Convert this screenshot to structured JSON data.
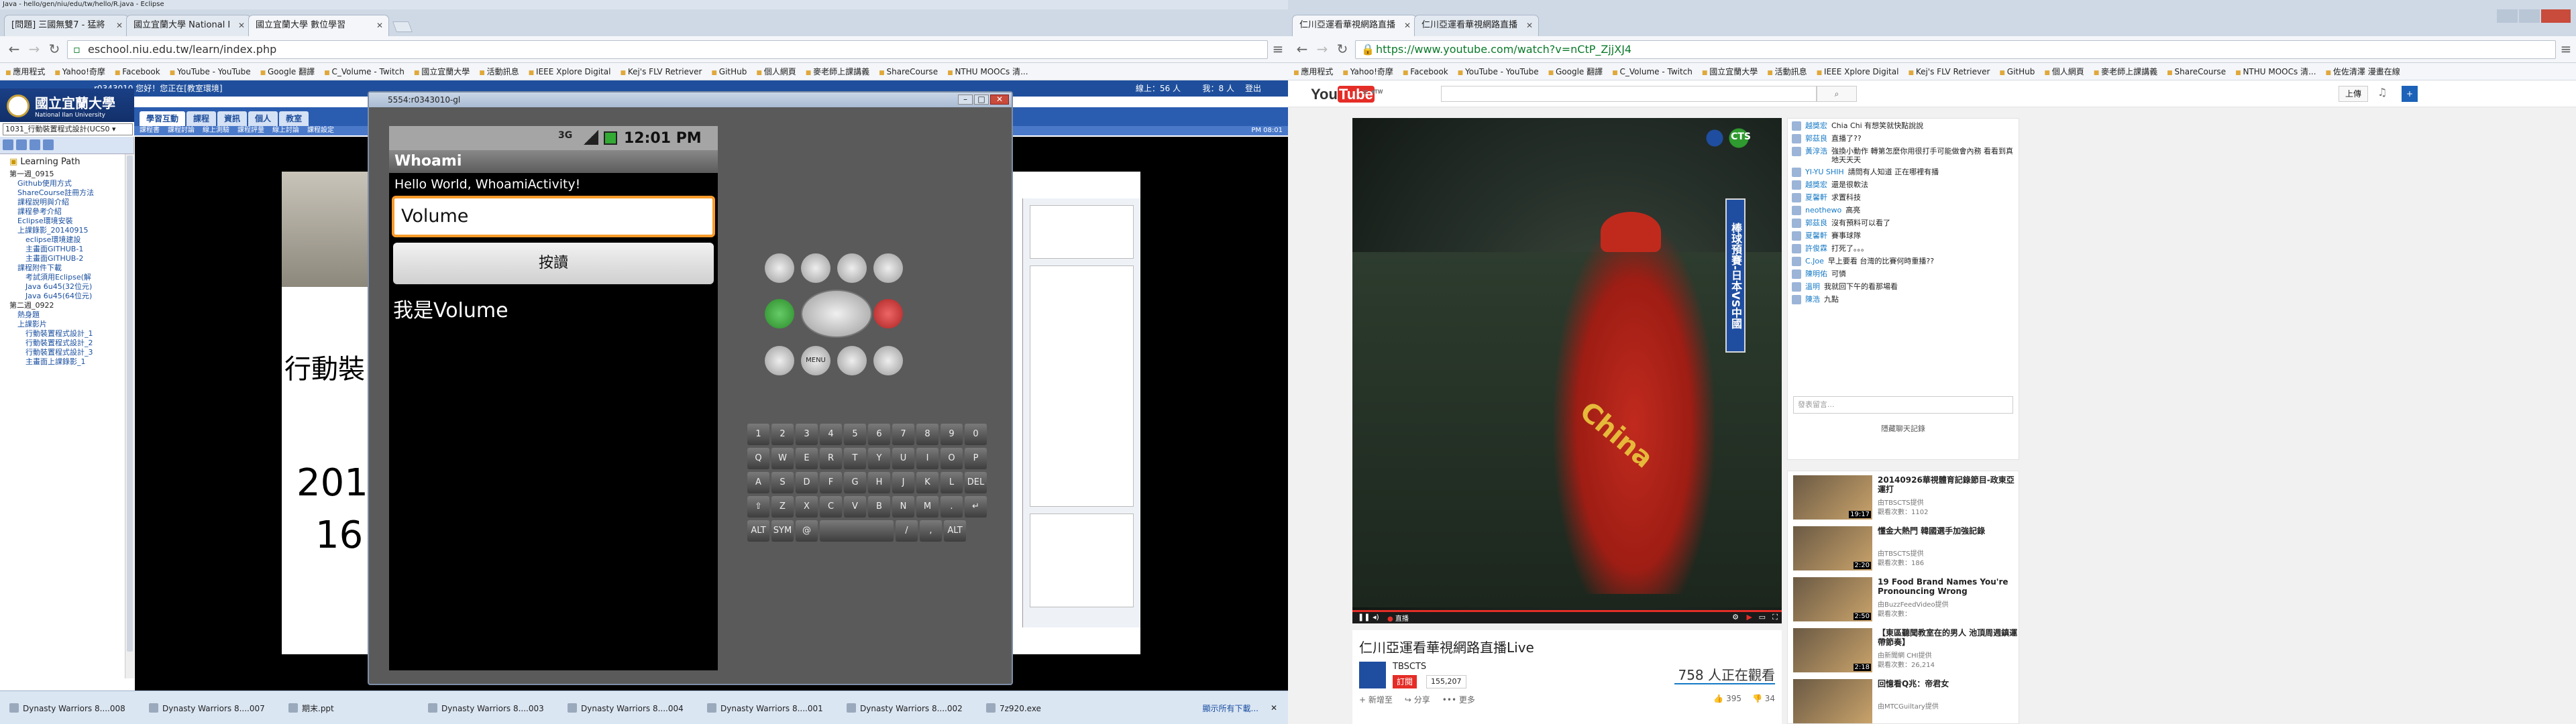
{
  "left_window": {
    "title": "Java - hello/gen/niu/edu/tw/hello/R.java - Eclipse",
    "tabs": [
      {
        "label": "[問題] 三國無雙7 - 猛將"
      },
      {
        "label": "國立宜蘭大學 National I"
      },
      {
        "label": "國立宜蘭大學 數位學習"
      }
    ],
    "url": "eschool.niu.edu.tw/learn/index.php",
    "bookmarks": [
      "應用程式",
      "Yahoo!奇摩",
      "Facebook",
      "YouTube - YouTube",
      "Google 翻譯",
      "C_Volume - Twitch",
      "國立宜蘭大學",
      "活動訊息",
      "IEEE Xplore Digital",
      "Kej's FLV Retriever",
      "GitHub",
      "個人網頁",
      "麥老師上課講義",
      "ShareCourse",
      "NTHU MOOCs 清..."
    ]
  },
  "eschool": {
    "header_text": "r0343010 您好！您正在[教室環境]",
    "online": "線上：56 人",
    "online2": "我：8 人",
    "logout": "登出",
    "logo": "國立宜蘭大學",
    "logo_sub": "National Ilan University",
    "course_select": "1031_行動裝置程式設計(UCS0",
    "nav_tabs": [
      "學習互動",
      "課程",
      "資訊",
      "個人",
      "教室"
    ],
    "subnav": [
      "課程書",
      "課程討論",
      "線上測驗",
      "課程評量",
      "線上討論",
      "課程設定"
    ],
    "time": "PM 08:01",
    "tree_title": "Learning Path",
    "tree": [
      "第一週_0915",
      "Github使用方式",
      "ShareCourse註冊方法",
      "課程說明與介紹",
      "課程參考介紹",
      "Eclipse環境安裝",
      "上課錄影_20140915",
      "eclipse環境建設",
      "主畫面GITHUB-1",
      "主畫面GITHUB-2",
      "課程附件下載",
      "考試須用Eclipse(解",
      "Java 6u45(32位元)",
      "Java 6u45(64位元)",
      "第二週_0922",
      "熱身題",
      "上課影片",
      "行動裝置程式設計_1",
      "行動裝置程式設計_2",
      "行動裝置程式設計_3",
      "主畫面上課錄影_1"
    ],
    "slide_text": [
      "行動裝",
      "2014",
      "16"
    ]
  },
  "emulator": {
    "title": "5554:r0343010-gl",
    "clock": "12:01 PM",
    "net": "3G",
    "app_title": "Whoami",
    "hello": "Hello World, WhoamiActivity!",
    "input_value": "Volume",
    "button": "按讀",
    "output": "我是Volume",
    "keys": [
      [
        "1",
        "2",
        "3",
        "4",
        "5",
        "6",
        "7",
        "8",
        "9",
        "0"
      ],
      [
        "Q",
        "W",
        "E",
        "R",
        "T",
        "Y",
        "U",
        "I",
        "O",
        "P"
      ],
      [
        "A",
        "S",
        "D",
        "F",
        "G",
        "H",
        "J",
        "K",
        "L",
        "DEL"
      ],
      [
        "⇧",
        "Z",
        "X",
        "C",
        "V",
        "B",
        "N",
        "M",
        ".",
        "↵"
      ],
      [
        "ALT",
        "SYM",
        "@",
        "",
        "/",
        ",",
        "ALT"
      ]
    ],
    "keys_sub": [
      [
        "!",
        "@",
        "#",
        "$",
        "%",
        "^",
        "&",
        "*",
        "(",
        ")"
      ]
    ],
    "dpad_label": "MENU"
  },
  "taskbar": {
    "items": [
      "Dynasty Warriors 8....008",
      "Dynasty Warriors 8....007",
      "期末.ppt",
      "Dynasty Warriors 8....003",
      "Dynasty Warriors 8....004",
      "Dynasty Warriors 8....001",
      "Dynasty Warriors 8....002",
      "7z920.exe"
    ],
    "show_all": "顯示所有下載...",
    "clock": "下午 08:01"
  },
  "right_window": {
    "tabs": [
      {
        "label": "仁川亞運看華視網路直播"
      },
      {
        "label": "仁川亞運看華視網路直播"
      }
    ],
    "url": "https://www.youtube.com/watch?v=nCtP_ZjjXJ4",
    "bookmarks": [
      "應用程式",
      "Yahoo!奇摩",
      "Facebook",
      "YouTube - YouTube",
      "Google 翻譯",
      "C_Volume - Twitch",
      "國立宜蘭大學",
      "活動訊息",
      "IEEE Xplore Digital",
      "Kej's FLV Retriever",
      "GitHub",
      "個人網頁",
      "麥老師上課講義",
      "ShareCourse",
      "NTHU MOOCs 清...",
      "佐佐清澤 漫畫在線"
    ]
  },
  "youtube": {
    "logo": "You",
    "logo2": "Tube",
    "logo_sup": "TW",
    "upload": "上傳",
    "video_title": "仁川亞運看華視網路直播Live",
    "channel": "TBSCTS",
    "subscribe": "訂閱",
    "sub_count": "155,207",
    "watching": "758 人正在觀看",
    "live": "直播",
    "likes": "395",
    "dislikes": "34",
    "actions": [
      "新增至",
      "分享",
      "更多"
    ],
    "overlay_logo": "CTS",
    "banner_text": "棒球預賽-日本VS中國",
    "jersey": "China",
    "chat": [
      {
        "user": "越獎宏",
        "msg": "Chia Chi 有想笑就快點說說"
      },
      {
        "user": "郭茲良",
        "msg": "直播了??"
      },
      {
        "user": "黃淳浩",
        "msg": "強換小動作 轉第怎麼你用很打手可能做會內務 看看到真地天天天"
      },
      {
        "user": "YI-YU SHIH",
        "msg": "請問有人知道 正在哪裡有播"
      },
      {
        "user": "越獎宏",
        "msg": "還是很軟法"
      },
      {
        "user": "夏馨軒",
        "msg": "求置科技"
      },
      {
        "user": "neothewo",
        "msg": "高亮"
      },
      {
        "user": "郭茲良",
        "msg": "沒有預料可以看了"
      },
      {
        "user": "夏馨軒",
        "msg": "賽事球隊"
      },
      {
        "user": "許俊霖",
        "msg": "打死了。。。"
      },
      {
        "user": "C.Joe",
        "msg": "早上要看 台灣的比賽何時重播??"
      },
      {
        "user": "陳明佑",
        "msg": "可憐"
      },
      {
        "user": "溫明",
        "msg": "我就回下午的看那場看"
      },
      {
        "user": "陳浩",
        "msg": "九點"
      }
    ],
    "chat_placeholder": "發表留言...",
    "chat_link": "隱藏聊天記錄",
    "related": [
      {
        "title": "20140926華視體育記錄節目-政東亞運打",
        "channel": "由TBSCTS提供",
        "views": "觀看次數：1102",
        "duration": "19:17"
      },
      {
        "title": "懂金大熱門 韓國選手加強記錄",
        "channel": "由TBSCTS提供",
        "views": "觀看次數：186",
        "duration": "2:20"
      },
      {
        "title": "19 Food Brand Names You're Pronouncing Wrong",
        "channel": "由BuzzFeedVideo提供",
        "views": "觀看次數：",
        "duration": "2:50"
      },
      {
        "title": "【東區聽聞教室在的男人 池頂周週鎮運帶節奏】",
        "channel": "由新聞網 CHI提供",
        "views": "觀看次數：26,214",
        "duration": "2:18"
      },
      {
        "title": "回憶看Q兆：帝君女",
        "channel": "由MTCGuiltary提供",
        "views": "",
        "duration": ""
      }
    ]
  }
}
